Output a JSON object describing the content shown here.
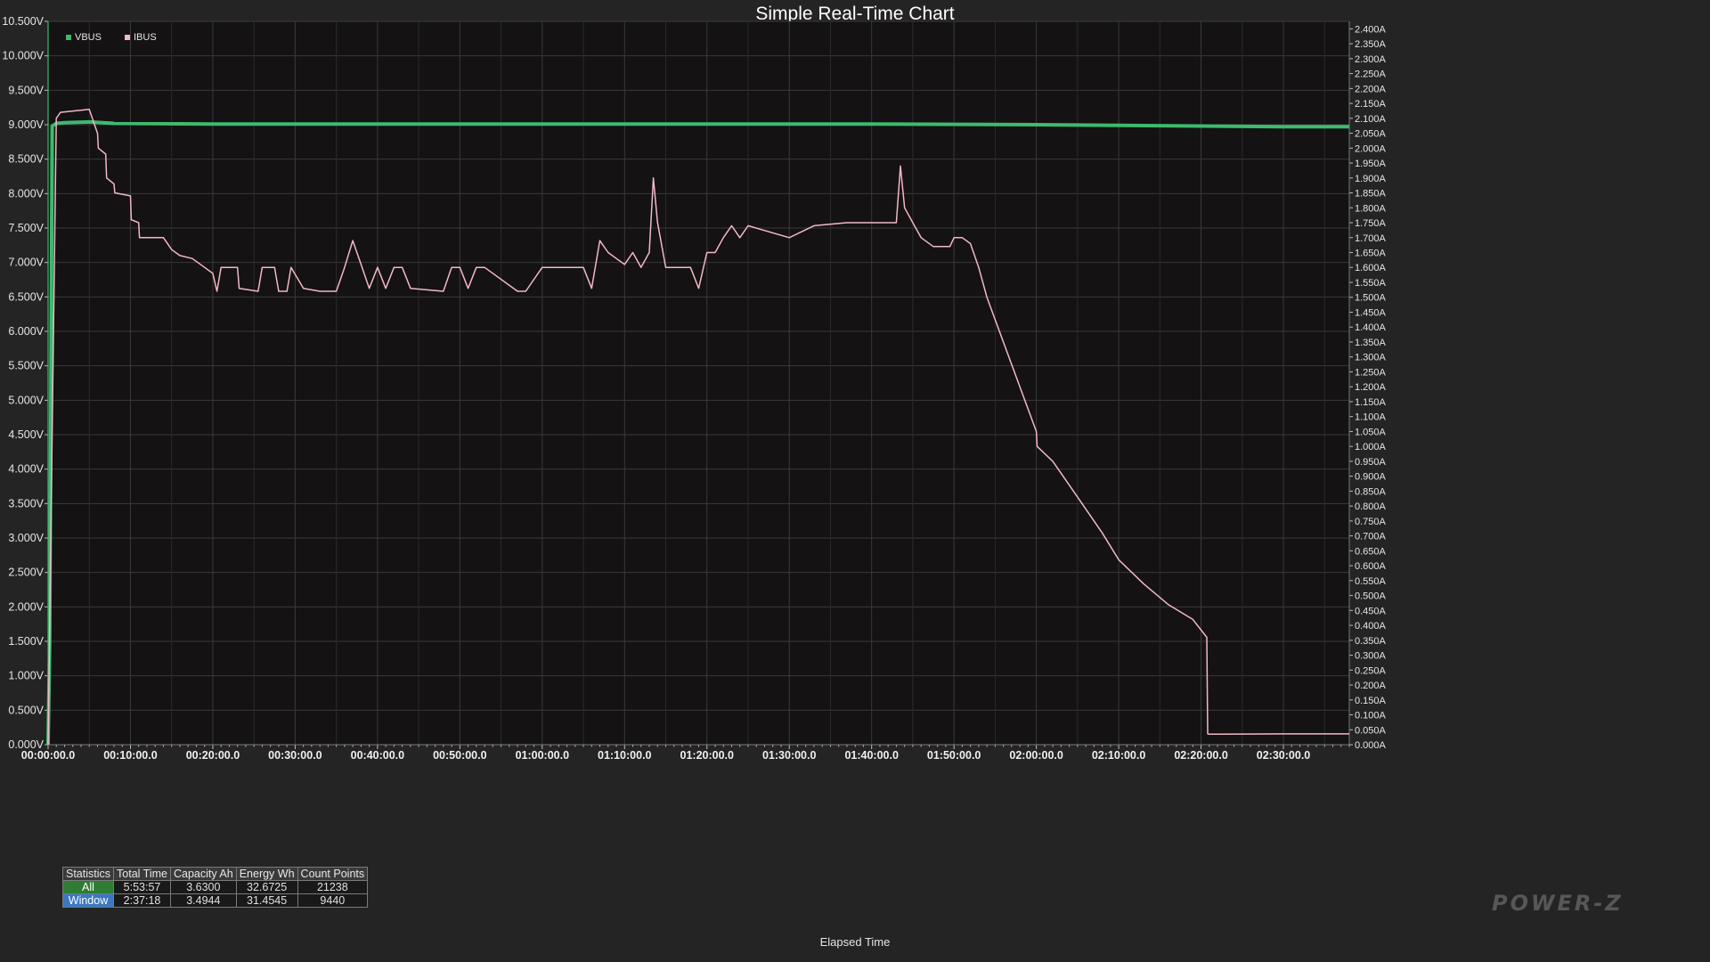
{
  "window": {
    "title": "Simple Real-Time Chart"
  },
  "colors": {
    "background": "#242424",
    "plot_background": "#141212",
    "grid": "#3a3a3a",
    "vbus": "#3dba6e",
    "ibus": "#f2b8c6"
  },
  "chart_data": {
    "type": "line",
    "title": "Simple Real-Time Chart",
    "xlabel": "Elapsed Time",
    "ylabel": "",
    "y2label": "",
    "xlim_minutes": [
      0,
      158
    ],
    "ylim": [
      0,
      10.5
    ],
    "y2lim": [
      0,
      2.425
    ],
    "grid": true,
    "legend_position": "top-left",
    "x_tick_labels": [
      "00:00:00.0",
      "00:10:00.0",
      "00:20:00.0",
      "00:30:00.0",
      "00:40:00.0",
      "00:50:00.0",
      "01:00:00.0",
      "01:10:00.0",
      "01:20:00.0",
      "01:30:00.0",
      "01:40:00.0",
      "01:50:00.0",
      "02:00:00.0",
      "02:10:00.0",
      "02:20:00.0",
      "02:30:00.0"
    ],
    "y_tick_labels": [
      "0.000V",
      "0.500V",
      "1.000V",
      "1.500V",
      "2.000V",
      "2.500V",
      "3.000V",
      "3.500V",
      "4.000V",
      "4.500V",
      "5.000V",
      "5.500V",
      "6.000V",
      "6.500V",
      "7.000V",
      "7.500V",
      "8.000V",
      "8.500V",
      "9.000V",
      "9.500V",
      "10.000V",
      "10.500V"
    ],
    "y2_tick_labels": [
      "0.000A",
      "0.050A",
      "0.100A",
      "0.150A",
      "0.200A",
      "0.250A",
      "0.300A",
      "0.350A",
      "0.400A",
      "0.450A",
      "0.500A",
      "0.550A",
      "0.600A",
      "0.650A",
      "0.700A",
      "0.750A",
      "0.800A",
      "0.850A",
      "0.900A",
      "0.950A",
      "1.000A",
      "1.050A",
      "1.100A",
      "1.150A",
      "1.200A",
      "1.250A",
      "1.300A",
      "1.350A",
      "1.400A",
      "1.450A",
      "1.500A",
      "1.550A",
      "1.600A",
      "1.650A",
      "1.700A",
      "1.750A",
      "1.800A",
      "1.850A",
      "1.900A",
      "1.950A",
      "2.000A",
      "2.050A",
      "2.100A",
      "2.150A",
      "2.200A",
      "2.250A",
      "2.300A",
      "2.350A",
      "2.400A"
    ],
    "series": [
      {
        "name": "VBUS",
        "axis": "left",
        "unit": "V",
        "x_minutes": [
          0,
          0.2,
          0.5,
          1.0,
          2.0,
          5.0,
          8.0,
          20.0,
          40.0,
          60.0,
          80.0,
          100.0,
          120.0,
          130.0,
          140.0,
          150.0,
          158.0
        ],
        "values": [
          0,
          1.5,
          8.98,
          9.02,
          9.03,
          9.04,
          9.02,
          9.01,
          9.01,
          9.01,
          9.01,
          9.01,
          9.0,
          8.99,
          8.98,
          8.97,
          8.97
        ]
      },
      {
        "name": "IBUS",
        "axis": "right",
        "unit": "A",
        "x_minutes": [
          0,
          1.0,
          1.5,
          5.0,
          6.0,
          6.1,
          7.0,
          7.1,
          8.0,
          8.1,
          10.0,
          10.1,
          11.0,
          11.1,
          14.0,
          15.0,
          16.0,
          17.5,
          19.0,
          20.0,
          20.5,
          21.0,
          23.0,
          23.2,
          25.5,
          26.0,
          27.5,
          28.0,
          29.0,
          29.5,
          31.0,
          33.0,
          34.0,
          35.0,
          36.0,
          37.0,
          38.0,
          39.0,
          40.0,
          41.0,
          42.0,
          43.0,
          44.0,
          48.0,
          49.0,
          50.0,
          51.0,
          52.0,
          53.0,
          57.0,
          58.0,
          60.0,
          61.0,
          65.0,
          66.0,
          67.0,
          68.0,
          69.0,
          70.0,
          71.0,
          72.0,
          73.0,
          73.5,
          74.0,
          75.0,
          78.0,
          79.0,
          80.0,
          81.0,
          82.0,
          83.0,
          84.0,
          85.0,
          90.0,
          93.0,
          97.0,
          100.0,
          101.0,
          103.0,
          103.5,
          104.0,
          105.0,
          106.0,
          107.5,
          109.5,
          110.0,
          111.0,
          112.0,
          113.0,
          114.0,
          116.0,
          118.0,
          120.0,
          120.1,
          122.0,
          125.0,
          128.0,
          130.0,
          133.0,
          136.0,
          139.0,
          140.7,
          140.8,
          141.0,
          150.0,
          158.0
        ],
        "values": [
          0,
          2.1,
          2.12,
          2.13,
          2.05,
          2.0,
          1.98,
          1.9,
          1.88,
          1.85,
          1.84,
          1.76,
          1.75,
          1.7,
          1.7,
          1.66,
          1.64,
          1.63,
          1.6,
          1.58,
          1.52,
          1.6,
          1.6,
          1.53,
          1.52,
          1.6,
          1.6,
          1.52,
          1.52,
          1.6,
          1.53,
          1.52,
          1.52,
          1.52,
          1.6,
          1.69,
          1.61,
          1.53,
          1.6,
          1.53,
          1.6,
          1.6,
          1.53,
          1.52,
          1.6,
          1.6,
          1.53,
          1.6,
          1.6,
          1.52,
          1.52,
          1.6,
          1.6,
          1.6,
          1.53,
          1.69,
          1.65,
          1.63,
          1.61,
          1.65,
          1.6,
          1.65,
          1.9,
          1.75,
          1.6,
          1.6,
          1.53,
          1.65,
          1.65,
          1.7,
          1.74,
          1.7,
          1.74,
          1.7,
          1.74,
          1.75,
          1.75,
          1.75,
          1.75,
          1.94,
          1.8,
          1.75,
          1.7,
          1.67,
          1.67,
          1.7,
          1.7,
          1.68,
          1.6,
          1.5,
          1.35,
          1.2,
          1.05,
          1.0,
          0.95,
          0.83,
          0.71,
          0.62,
          0.54,
          0.47,
          0.42,
          0.36,
          0.036,
          0.035,
          0.036,
          0.036
        ]
      }
    ]
  },
  "statistics": {
    "headers": [
      "Statistics",
      "Total Time",
      "Capacity Ah",
      "Energy Wh",
      "Count Points"
    ],
    "rows": [
      {
        "label": "All",
        "total_time": "5:53:57",
        "capacity": "3.6300",
        "energy": "32.6725",
        "count": "21238"
      },
      {
        "label": "Window",
        "total_time": "2:37:18",
        "capacity": "3.4944",
        "energy": "31.4545",
        "count": "9440"
      }
    ]
  },
  "watermark": "POWER-Z"
}
